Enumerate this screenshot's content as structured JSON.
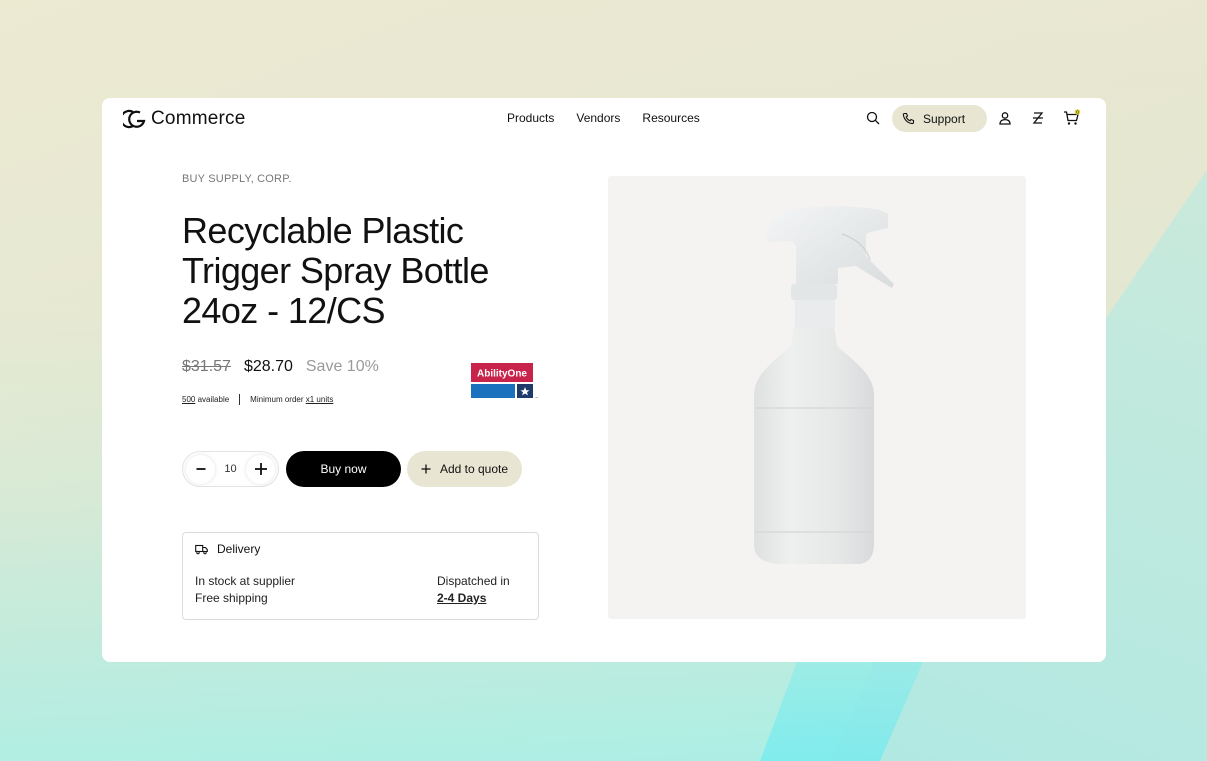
{
  "brand": {
    "name": "Commerce"
  },
  "nav": {
    "items": [
      "Products",
      "Vendors",
      "Resources"
    ]
  },
  "header": {
    "support_label": "Support",
    "cart_count": "0"
  },
  "product": {
    "vendor": "BUY SUPPLY, CORP.",
    "title": "Recyclable Plastic Trigger Spray Bottle 24oz - 12/CS",
    "old_price": "$31.57",
    "price": "$28.70",
    "savings": "Save 10%",
    "available_count": "500",
    "available_label": "available",
    "min_order_label": "Minimum order",
    "min_order_value": "x1 units",
    "badge_text": "AbilityOne",
    "quantity": "10",
    "buy_label": "Buy now",
    "quote_label": "Add to quote"
  },
  "delivery": {
    "heading": "Delivery",
    "stock_text": "In stock at supplier",
    "shipping_text": "Free shipping",
    "dispatch_label": "Dispatched in",
    "dispatch_value": "2-4 Days"
  },
  "icons": [
    "logo-icon",
    "search-icon",
    "phone-icon",
    "user-icon",
    "currency-icon",
    "cart-icon",
    "minus-icon",
    "plus-icon",
    "truck-icon"
  ]
}
